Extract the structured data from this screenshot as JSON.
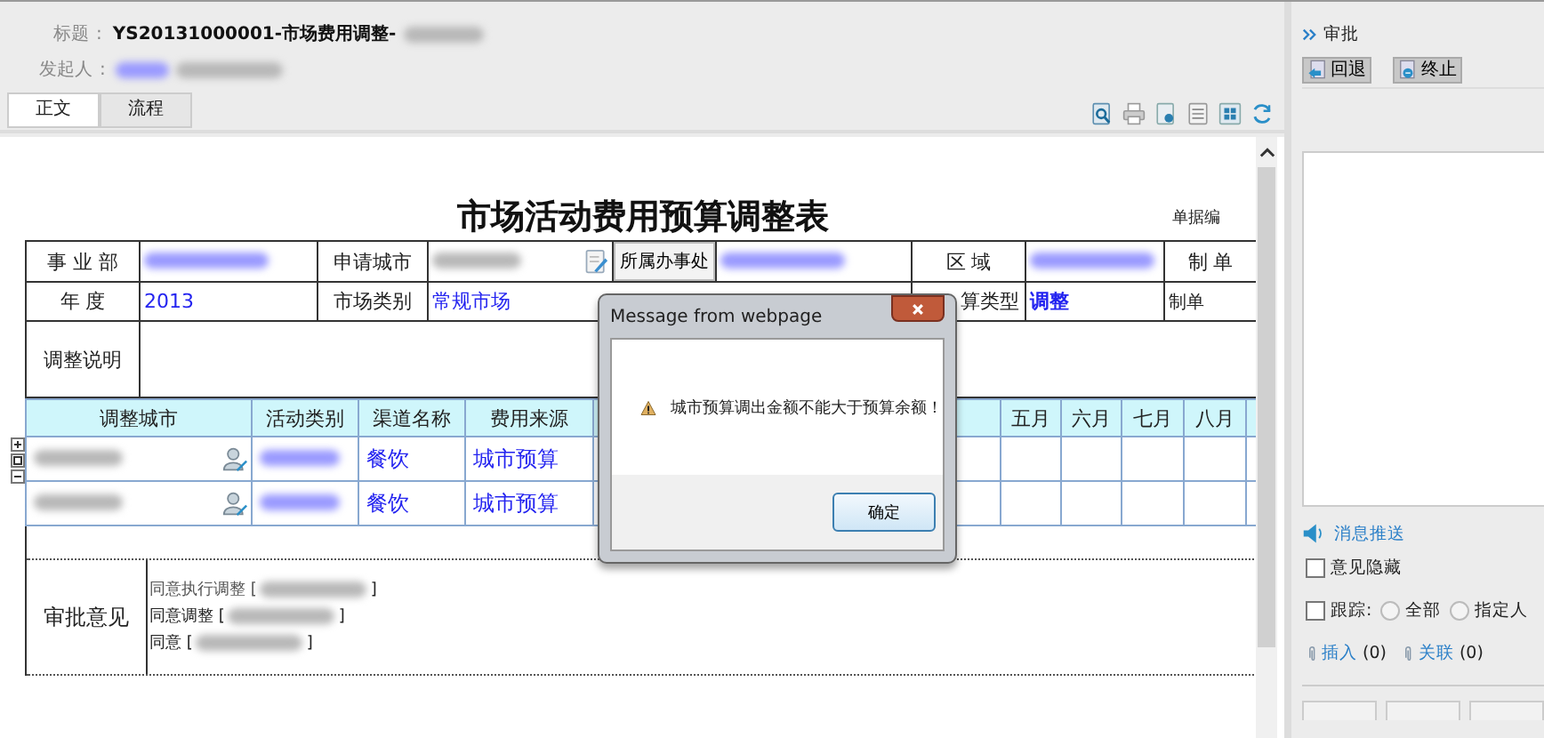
{
  "header": {
    "title_label": "标题",
    "separator": ":",
    "title": "YS20131000001-市场费用调整-",
    "initiator_label": "发起人",
    "initiator_separator": ":"
  },
  "tabs": [
    {
      "label": "正文",
      "selected": true
    },
    {
      "label": "流程",
      "selected": false
    }
  ],
  "document": {
    "title": "市场活动费用预算调整表",
    "doc_no_label": "单据编",
    "form_rows": [
      [
        {
          "kind": "label",
          "text": "事 业 部"
        },
        {
          "kind": "blurred-link"
        },
        {
          "kind": "label",
          "text": "申请城市"
        },
        {
          "kind": "blurred-edit"
        },
        {
          "kind": "button",
          "text": "所属办事处"
        },
        {
          "kind": "blurred-link"
        },
        {
          "kind": "label",
          "text": "区 域"
        },
        {
          "kind": "blurred-link"
        },
        {
          "kind": "label",
          "text": "制 单"
        }
      ],
      [
        {
          "kind": "label",
          "text": "年 度"
        },
        {
          "kind": "value",
          "text": "2013"
        },
        {
          "kind": "label",
          "text": "市场类别"
        },
        {
          "kind": "wide-value",
          "text": "常规市场"
        },
        {
          "kind": "label",
          "text": "算类型"
        },
        {
          "kind": "strong-value",
          "text": "调整"
        },
        {
          "kind": "small-label",
          "text": "制单"
        }
      ],
      [
        {
          "kind": "label",
          "text": "调整说明"
        },
        {
          "kind": "fill"
        }
      ]
    ],
    "detail_columns_left": [
      "调整城市",
      "活动类别",
      "渠道名称",
      "费用来源"
    ],
    "detail_columns_right": [
      "五月",
      "六月",
      "七月",
      "八月"
    ],
    "detail_rows": [
      {
        "channel": "餐饮",
        "source": "城市预算"
      },
      {
        "channel": "餐饮",
        "source": "城市预算"
      }
    ],
    "approval": {
      "label": "审批意见",
      "entries": [
        {
          "text": "同意执行调整 [",
          "close": "]"
        },
        {
          "text": "同意调整 [",
          "close": "]"
        },
        {
          "text": "同意 [",
          "close": "]"
        }
      ]
    }
  },
  "dialog": {
    "title": "Message from webpage",
    "message": "城市预算调出金额不能大于预算余额！",
    "button": "确定"
  },
  "side": {
    "title": "审批",
    "actions": [
      {
        "label": "回退"
      },
      {
        "label": "终止"
      }
    ],
    "push_link": "消息推送",
    "hide_opinion": {
      "label": "意见隐藏",
      "checked": false
    },
    "track": {
      "label": "跟踪:",
      "checked": false,
      "options": [
        {
          "label": "全部",
          "selected": false
        },
        {
          "label": "指定人",
          "selected": false
        }
      ]
    },
    "attachments": [
      {
        "label": "插入",
        "count": "(0)"
      },
      {
        "label": "关联",
        "count": "(0)"
      }
    ]
  }
}
